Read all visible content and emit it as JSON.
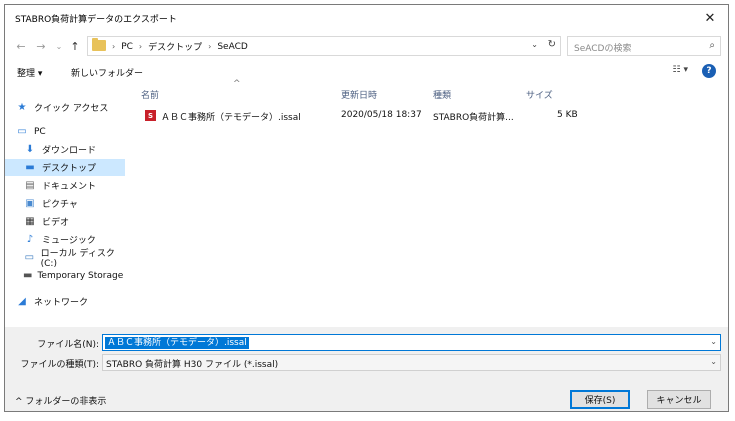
{
  "window": {
    "title": "STABRO負荷計算データのエクスポート"
  },
  "nav": {
    "breadcrumbs": [
      "PC",
      "デスクトップ",
      "SeACD"
    ],
    "search_placeholder": "SeACDの検索"
  },
  "toolbar": {
    "organize": "整理 ▾",
    "new_folder": "新しいフォルダー",
    "help": "?"
  },
  "sidebar": {
    "items": [
      {
        "label": "クイック アクセス",
        "icon": "star-icon"
      },
      {
        "label": "PC",
        "icon": "pc-icon"
      },
      {
        "label": "ダウンロード",
        "icon": "download-icon"
      },
      {
        "label": "デスクトップ",
        "icon": "desktop-icon",
        "selected": true
      },
      {
        "label": "ドキュメント",
        "icon": "document-icon"
      },
      {
        "label": "ピクチャ",
        "icon": "picture-icon"
      },
      {
        "label": "ビデオ",
        "icon": "video-icon"
      },
      {
        "label": "ミュージック",
        "icon": "music-icon"
      },
      {
        "label": "ローカル ディスク (C:)",
        "icon": "drive-icon"
      },
      {
        "label": "Temporary Storage (",
        "icon": "storage-icon"
      },
      {
        "label": "ネットワーク",
        "icon": "network-icon"
      }
    ]
  },
  "columns": {
    "name": "名前",
    "modified": "更新日時",
    "type": "種類",
    "size": "サイズ"
  },
  "files": [
    {
      "name": "ＡＢＣ事務所（テモデータ）.issal",
      "modified": "2020/05/18 18:37",
      "type": "STABRO負荷計算...",
      "size": "5 KB"
    }
  ],
  "bottom": {
    "filename_label": "ファイル名(N):",
    "filename_value": "ＡＢＣ事務所（テモデータ）.issal",
    "filetype_label": "ファイルの種類(T):",
    "filetype_value": "STABRO 負荷計算 H30 ファイル (*.issal)",
    "hide_folders": "フォルダーの非表示",
    "save": "保存(S)",
    "cancel": "キャンセル"
  },
  "colors": {
    "accent": "#0078d7",
    "selected_bg": "#cce8ff",
    "header_text": "#4d6082"
  }
}
